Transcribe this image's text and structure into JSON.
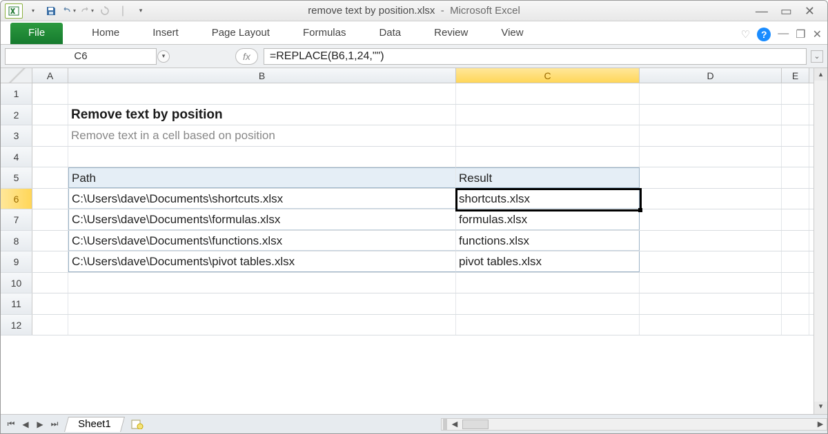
{
  "window_title": {
    "filename": "remove text by position.xlsx",
    "app": "Microsoft Excel"
  },
  "ribbon": {
    "file": "File",
    "tabs": [
      "Home",
      "Insert",
      "Page Layout",
      "Formulas",
      "Data",
      "Review",
      "View"
    ]
  },
  "namebox": "C6",
  "formula": "=REPLACE(B6,1,24,\"\")",
  "columns": [
    "A",
    "B",
    "C",
    "D",
    "E"
  ],
  "rows": [
    1,
    2,
    3,
    4,
    5,
    6,
    7,
    8,
    9,
    10,
    11,
    12
  ],
  "content": {
    "title": "Remove text by position",
    "subtitle": "Remove text in a cell based on position",
    "hdr_path": "Path",
    "hdr_result": "Result",
    "data": [
      {
        "path": "C:\\Users\\dave\\Documents\\shortcuts.xlsx",
        "result": "shortcuts.xlsx"
      },
      {
        "path": "C:\\Users\\dave\\Documents\\formulas.xlsx",
        "result": "formulas.xlsx"
      },
      {
        "path": "C:\\Users\\dave\\Documents\\functions.xlsx",
        "result": "functions.xlsx"
      },
      {
        "path": "C:\\Users\\dave\\Documents\\pivot tables.xlsx",
        "result": "pivot tables.xlsx"
      }
    ]
  },
  "sheet_tab": "Sheet1",
  "active": {
    "row": 6,
    "col": "C"
  }
}
